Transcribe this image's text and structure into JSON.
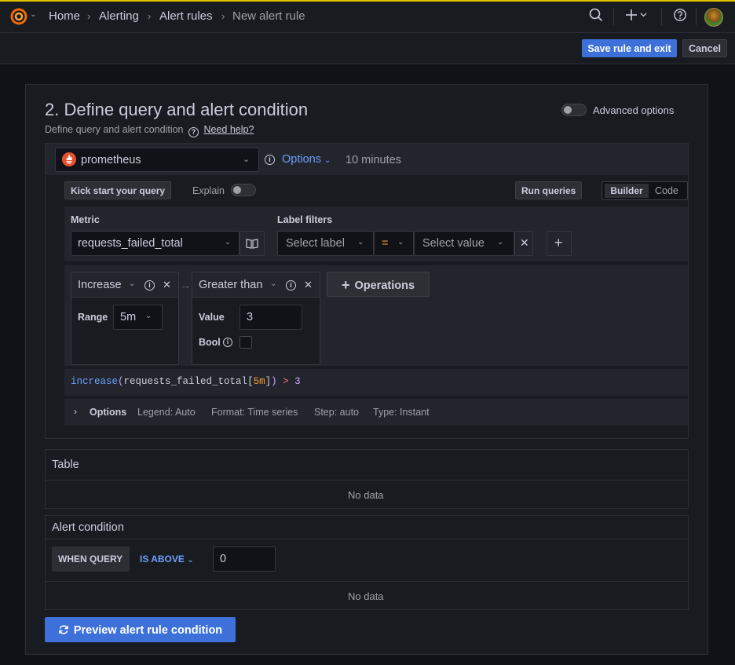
{
  "topbar": {
    "breadcrumbs": [
      "Home",
      "Alerting",
      "Alert rules",
      "New alert rule"
    ],
    "icons": [
      "grafana-logo-icon",
      "search-icon",
      "plus-icon",
      "help-icon",
      "avatar"
    ]
  },
  "actions": {
    "save_label": "Save rule and exit",
    "cancel_label": "Cancel"
  },
  "section": {
    "title": "2. Define query and alert condition",
    "subtitle": "Define query and alert condition",
    "help_link": "Need help?",
    "advanced_options_label": "Advanced options",
    "advanced_options_enabled": false
  },
  "query": {
    "datasource": "prometheus",
    "options_label": "Options",
    "time_range": "10 minutes",
    "kick_start_label": "Kick start your query",
    "explain_label": "Explain",
    "explain_enabled": false,
    "run_queries_label": "Run queries",
    "mode_builder": "Builder",
    "mode_code": "Code",
    "metric_label": "Metric",
    "metric_value": "requests_failed_total",
    "label_filters_label": "Label filters",
    "select_label_placeholder": "Select label",
    "operator": "=",
    "select_value_placeholder": "Select value",
    "operations_button": "Operations",
    "op1": {
      "name": "Increase",
      "range_label": "Range",
      "range_value": "5m"
    },
    "op2": {
      "name": "Greater than",
      "value_label": "Value",
      "value": "3",
      "bool_label": "Bool",
      "bool_checked": false
    },
    "expression": {
      "fn": "increase",
      "open": "(",
      "metric": "requests_failed_total",
      "lb": "[",
      "dur": "5m",
      "rb": "]",
      "close": ")",
      "op": " > ",
      "num": "3"
    },
    "options_row": {
      "label": "Options",
      "legend": "Legend: Auto",
      "format": "Format: Time series",
      "step": "Step: auto",
      "type": "Type: Instant"
    }
  },
  "table": {
    "title": "Table",
    "no_data": "No data"
  },
  "alert_condition": {
    "title": "Alert condition",
    "when_query": "WHEN QUERY",
    "is_above": "IS ABOVE",
    "threshold": "0",
    "no_data": "No data"
  },
  "preview_button": "Preview alert rule condition",
  "colors": {
    "primary": "#3d71d9",
    "link": "#6e9fff",
    "background": "#111217",
    "panel": "#181b1f",
    "prometheus": "#e6522c"
  }
}
